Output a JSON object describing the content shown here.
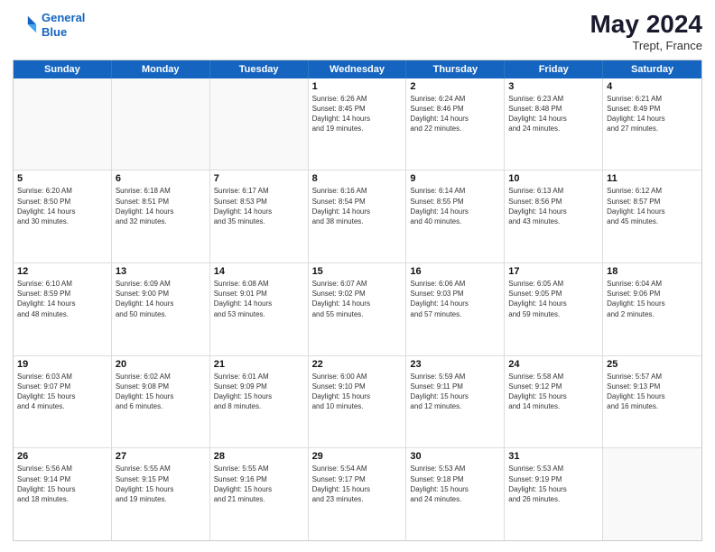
{
  "logo": {
    "line1": "General",
    "line2": "Blue"
  },
  "title": "May 2024",
  "location": "Trept, France",
  "dayHeaders": [
    "Sunday",
    "Monday",
    "Tuesday",
    "Wednesday",
    "Thursday",
    "Friday",
    "Saturday"
  ],
  "weeks": [
    [
      {
        "num": "",
        "info": ""
      },
      {
        "num": "",
        "info": ""
      },
      {
        "num": "",
        "info": ""
      },
      {
        "num": "1",
        "info": "Sunrise: 6:26 AM\nSunset: 8:45 PM\nDaylight: 14 hours\nand 19 minutes."
      },
      {
        "num": "2",
        "info": "Sunrise: 6:24 AM\nSunset: 8:46 PM\nDaylight: 14 hours\nand 22 minutes."
      },
      {
        "num": "3",
        "info": "Sunrise: 6:23 AM\nSunset: 8:48 PM\nDaylight: 14 hours\nand 24 minutes."
      },
      {
        "num": "4",
        "info": "Sunrise: 6:21 AM\nSunset: 8:49 PM\nDaylight: 14 hours\nand 27 minutes."
      }
    ],
    [
      {
        "num": "5",
        "info": "Sunrise: 6:20 AM\nSunset: 8:50 PM\nDaylight: 14 hours\nand 30 minutes."
      },
      {
        "num": "6",
        "info": "Sunrise: 6:18 AM\nSunset: 8:51 PM\nDaylight: 14 hours\nand 32 minutes."
      },
      {
        "num": "7",
        "info": "Sunrise: 6:17 AM\nSunset: 8:53 PM\nDaylight: 14 hours\nand 35 minutes."
      },
      {
        "num": "8",
        "info": "Sunrise: 6:16 AM\nSunset: 8:54 PM\nDaylight: 14 hours\nand 38 minutes."
      },
      {
        "num": "9",
        "info": "Sunrise: 6:14 AM\nSunset: 8:55 PM\nDaylight: 14 hours\nand 40 minutes."
      },
      {
        "num": "10",
        "info": "Sunrise: 6:13 AM\nSunset: 8:56 PM\nDaylight: 14 hours\nand 43 minutes."
      },
      {
        "num": "11",
        "info": "Sunrise: 6:12 AM\nSunset: 8:57 PM\nDaylight: 14 hours\nand 45 minutes."
      }
    ],
    [
      {
        "num": "12",
        "info": "Sunrise: 6:10 AM\nSunset: 8:59 PM\nDaylight: 14 hours\nand 48 minutes."
      },
      {
        "num": "13",
        "info": "Sunrise: 6:09 AM\nSunset: 9:00 PM\nDaylight: 14 hours\nand 50 minutes."
      },
      {
        "num": "14",
        "info": "Sunrise: 6:08 AM\nSunset: 9:01 PM\nDaylight: 14 hours\nand 53 minutes."
      },
      {
        "num": "15",
        "info": "Sunrise: 6:07 AM\nSunset: 9:02 PM\nDaylight: 14 hours\nand 55 minutes."
      },
      {
        "num": "16",
        "info": "Sunrise: 6:06 AM\nSunset: 9:03 PM\nDaylight: 14 hours\nand 57 minutes."
      },
      {
        "num": "17",
        "info": "Sunrise: 6:05 AM\nSunset: 9:05 PM\nDaylight: 14 hours\nand 59 minutes."
      },
      {
        "num": "18",
        "info": "Sunrise: 6:04 AM\nSunset: 9:06 PM\nDaylight: 15 hours\nand 2 minutes."
      }
    ],
    [
      {
        "num": "19",
        "info": "Sunrise: 6:03 AM\nSunset: 9:07 PM\nDaylight: 15 hours\nand 4 minutes."
      },
      {
        "num": "20",
        "info": "Sunrise: 6:02 AM\nSunset: 9:08 PM\nDaylight: 15 hours\nand 6 minutes."
      },
      {
        "num": "21",
        "info": "Sunrise: 6:01 AM\nSunset: 9:09 PM\nDaylight: 15 hours\nand 8 minutes."
      },
      {
        "num": "22",
        "info": "Sunrise: 6:00 AM\nSunset: 9:10 PM\nDaylight: 15 hours\nand 10 minutes."
      },
      {
        "num": "23",
        "info": "Sunrise: 5:59 AM\nSunset: 9:11 PM\nDaylight: 15 hours\nand 12 minutes."
      },
      {
        "num": "24",
        "info": "Sunrise: 5:58 AM\nSunset: 9:12 PM\nDaylight: 15 hours\nand 14 minutes."
      },
      {
        "num": "25",
        "info": "Sunrise: 5:57 AM\nSunset: 9:13 PM\nDaylight: 15 hours\nand 16 minutes."
      }
    ],
    [
      {
        "num": "26",
        "info": "Sunrise: 5:56 AM\nSunset: 9:14 PM\nDaylight: 15 hours\nand 18 minutes."
      },
      {
        "num": "27",
        "info": "Sunrise: 5:55 AM\nSunset: 9:15 PM\nDaylight: 15 hours\nand 19 minutes."
      },
      {
        "num": "28",
        "info": "Sunrise: 5:55 AM\nSunset: 9:16 PM\nDaylight: 15 hours\nand 21 minutes."
      },
      {
        "num": "29",
        "info": "Sunrise: 5:54 AM\nSunset: 9:17 PM\nDaylight: 15 hours\nand 23 minutes."
      },
      {
        "num": "30",
        "info": "Sunrise: 5:53 AM\nSunset: 9:18 PM\nDaylight: 15 hours\nand 24 minutes."
      },
      {
        "num": "31",
        "info": "Sunrise: 5:53 AM\nSunset: 9:19 PM\nDaylight: 15 hours\nand 26 minutes."
      },
      {
        "num": "",
        "info": ""
      }
    ]
  ]
}
